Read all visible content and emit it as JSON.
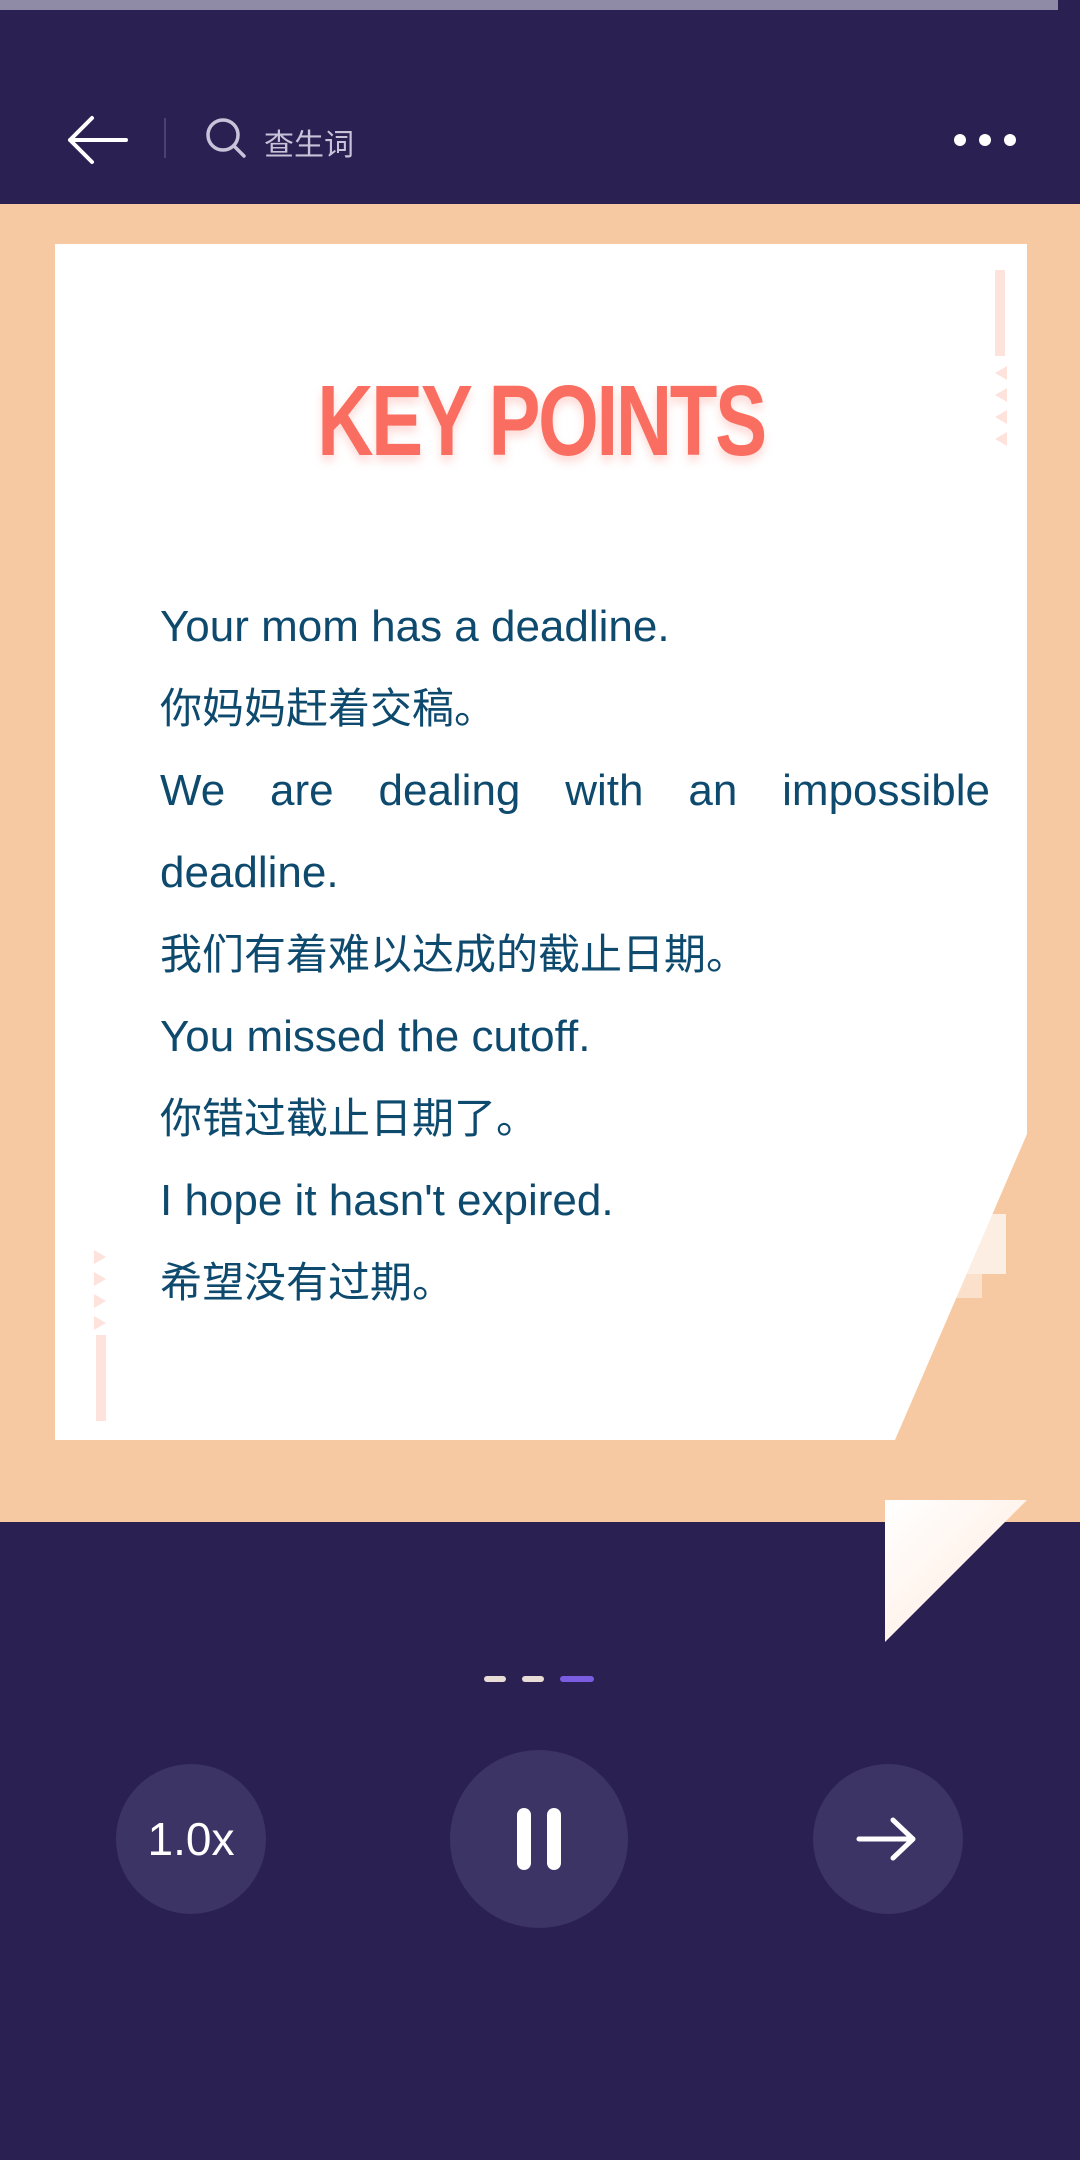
{
  "progress": {
    "fraction": 0.98
  },
  "header": {
    "back_icon": "arrow-left-icon",
    "search_icon": "search-icon",
    "search_label": "查生词",
    "more_icon": "more-dots-icon"
  },
  "card": {
    "title": "KEY POINTS",
    "lines": [
      {
        "text": "Your mom has a deadline.",
        "lang": "en"
      },
      {
        "text": "你妈妈赶着交稿。",
        "lang": "zh"
      },
      {
        "text": "We are dealing with an impossible deadline.",
        "lang": "en"
      },
      {
        "text": "我们有着难以达成的截止日期。",
        "lang": "zh"
      },
      {
        "text": "You missed the cutoff.",
        "lang": "en"
      },
      {
        "text": "你错过截止日期了。",
        "lang": "zh"
      },
      {
        "text": "I hope it hasn't expired.",
        "lang": "en"
      },
      {
        "text": "希望没有过期。",
        "lang": "zh"
      }
    ]
  },
  "pager": {
    "count": 3,
    "active_index": 2
  },
  "controls": {
    "speed_label": "1.0x",
    "play_icon": "pause-icon",
    "next_icon": "arrow-right-icon"
  },
  "colors": {
    "background": "#2a2052",
    "card_area": "#f7c9a2",
    "title": "#f96e60",
    "body_text": "#0e4a6e",
    "button": "#3d3466",
    "active_dot": "#7a5de0"
  }
}
